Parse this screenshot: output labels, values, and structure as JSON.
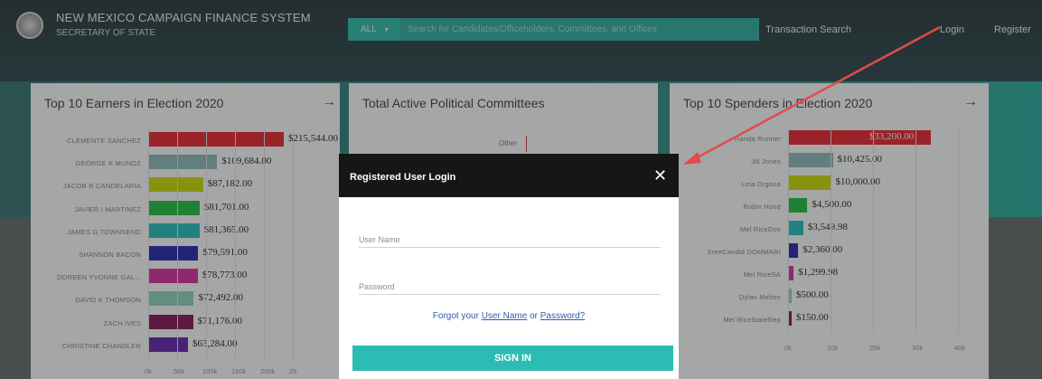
{
  "header": {
    "title": "NEW MEXICO CAMPAIGN FINANCE SYSTEM",
    "subtitle": "SECRETARY OF STATE",
    "search_scope": "ALL",
    "search_placeholder": "Search for Candidates/Officeholders, Committees, and Offices",
    "nav": {
      "transaction_search": "Transaction Search",
      "login": "Login",
      "register": "Register"
    }
  },
  "earners": {
    "title": "Top 10 Earners in Election 2020",
    "rows": [
      {
        "name": "CLEMENTE SANCHEZ",
        "label": "$215,544.00",
        "color": "#e0202a"
      },
      {
        "name": "GEORGE K MUNOZ",
        "label": "$109,684.00",
        "color": "#86b4b4"
      },
      {
        "name": "JACOB R CANDELARIA",
        "label": "$87,182.00",
        "color": "#c4d400"
      },
      {
        "name": "JAVIER I MARTINEZ",
        "label": "$81,701.00",
        "color": "#1ab83c"
      },
      {
        "name": "JAMES G TOWNSEND",
        "label": "$81,365.00",
        "color": "#20b6b8"
      },
      {
        "name": "SHANNON BACON",
        "label": "$79,591.00",
        "color": "#1f24a8"
      },
      {
        "name": "DOREEN YVONNE GAL...",
        "label": "$78,773.00",
        "color": "#d02a95"
      },
      {
        "name": "DAVID K THOMSON",
        "label": "$72,492.00",
        "color": "#86cbb8"
      },
      {
        "name": "ZACH IVES",
        "label": "$71,176.00",
        "color": "#7c1354"
      },
      {
        "name": "CHRISTINE CHANDLER",
        "label": "$63,284.00",
        "color": "#5c1fa8"
      }
    ],
    "ticks": [
      "0k",
      "50k",
      "100k",
      "150k",
      "200k",
      "25"
    ]
  },
  "committees": {
    "title": "Total Active Political Committees",
    "legend_other": "Other"
  },
  "spenders": {
    "title": "Top 10 Spenders in Election 2020",
    "rows": [
      {
        "name": "Randa Runner",
        "label": "$33,200.00",
        "color": "#e0202a"
      },
      {
        "name": "Jill Jones",
        "label": "$10,425.00",
        "color": "#86b4b4"
      },
      {
        "name": "Leia Organa",
        "label": "$10,000.00",
        "color": "#c4d400"
      },
      {
        "name": "Robin Hood",
        "label": "$4,500.00",
        "color": "#1ab83c"
      },
      {
        "name": "Mel RiceGov",
        "label": "$3,549.98",
        "color": "#20b6b8"
      },
      {
        "name": "SreeCandid DOMMARI",
        "label": "$2,360.00",
        "color": "#1f24a8"
      },
      {
        "name": "Mel RiceSA",
        "label": "$1,299.98",
        "color": "#d02a95"
      },
      {
        "name": "Dylan Melton",
        "label": "$500.00",
        "color": "#86cbb8"
      },
      {
        "name": "Mel RiceStateRep",
        "label": "$150.00",
        "color": "#7c1354"
      }
    ],
    "ticks": [
      "0k",
      "10k",
      "20k",
      "30k",
      "40k"
    ]
  },
  "login_modal": {
    "title": "Registered User Login",
    "close": "✕",
    "username_label": "User Name",
    "password_label": "Password",
    "forgot_prefix": "Forgot your",
    "forgot_username": "User Name",
    "forgot_or": "or",
    "forgot_password": "Password?",
    "sign_in": "SIGN IN"
  }
}
